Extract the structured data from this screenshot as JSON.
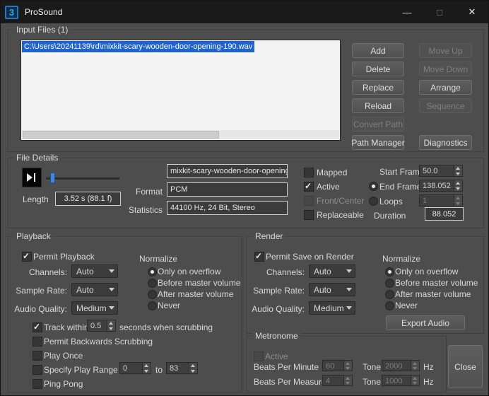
{
  "colors": {
    "selection_blue": "#2063cf",
    "accent_blue": "#3e86d8",
    "titlebar_bg": "#1a1a1a",
    "dialog_bg": "#4d4d4d"
  },
  "titlebar": {
    "icon": "3",
    "title": "ProSound",
    "minimize": "—",
    "maximize": "□",
    "close": "✕"
  },
  "input_files": {
    "label": "Input Files (1)",
    "file_path": "C:\\Users\\20241139\\rd\\mixkit-scary-wooden-door-opening-190.wav",
    "buttons": {
      "add": "Add",
      "delete": "Delete",
      "replace": "Replace",
      "reload": "Reload",
      "convert_path": "Convert Path",
      "path_manager": "Path Manager",
      "move_up": "Move Up",
      "move_down": "Move Down",
      "arrange": "Arrange",
      "sequence": "Sequence",
      "diagnostics": "Diagnostics"
    }
  },
  "file_details": {
    "label": "File Details",
    "length_label": "Length",
    "length_value": "3.52 s (88.1 f)",
    "file_name": "mixkit-scary-wooden-door-opening",
    "format_label": "Format",
    "format_value": "PCM",
    "statistics_label": "Statistics",
    "statistics_value": "44100 Hz, 24 Bit, Stereo",
    "mapped": "Mapped",
    "active": "Active",
    "front_center": "Front/Center",
    "replaceable": "Replaceable",
    "start_frame_label": "Start Frame",
    "start_frame_value": "50.0",
    "end_frame_label": "End Frame",
    "end_frame_value": "138.052",
    "loops_label": "Loops",
    "loops_value": "1",
    "duration_label": "Duration",
    "duration_value": "88.052"
  },
  "playback": {
    "label": "Playback",
    "permit_playback": "Permit Playback",
    "channels_label": "Channels:",
    "channels_value": "Auto",
    "sample_rate_label": "Sample Rate:",
    "sample_rate_value": "Auto",
    "audio_quality_label": "Audio Quality:",
    "audio_quality_value": "Medium",
    "normalize_label": "Normalize",
    "normalize_options": [
      "Only on overflow",
      "Before master volume",
      "After master volume",
      "Never"
    ],
    "track_within_label": "Track within",
    "track_within_value": "0.5",
    "track_within_suffix": "seconds when scrubbing",
    "permit_backwards": "Permit Backwards Scrubbing",
    "play_once": "Play Once",
    "specify_play_range": "Specify Play Range",
    "range_start": "0",
    "range_to": "to",
    "range_end": "83",
    "ping_pong": "Ping Pong"
  },
  "render": {
    "label": "Render",
    "permit_save": "Permit Save on Render",
    "channels_label": "Channels:",
    "channels_value": "Auto",
    "sample_rate_label": "Sample Rate:",
    "sample_rate_value": "Auto",
    "audio_quality_label": "Audio Quality:",
    "audio_quality_value": "Medium",
    "normalize_label": "Normalize",
    "normalize_options": [
      "Only on overflow",
      "Before master volume",
      "After master volume",
      "Never"
    ],
    "export_audio": "Export Audio"
  },
  "metronome": {
    "label": "Metronome",
    "active": "Active",
    "beats_per_minute_label": "Beats Per Minute",
    "beats_per_minute_value": "60",
    "tone_label": "Tone",
    "tone_minute_value": "2000",
    "hz": "Hz",
    "beats_per_measure_label": "Beats Per Measure",
    "beats_per_measure_value": "4",
    "tone_measure_value": "1000"
  },
  "close_button": "Close"
}
